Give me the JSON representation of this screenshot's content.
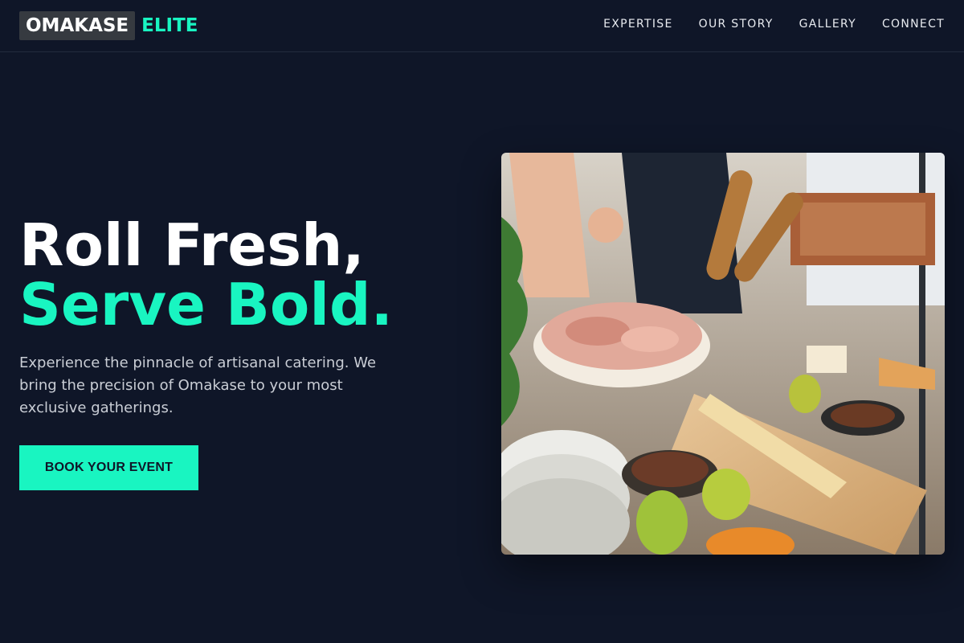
{
  "header": {
    "logo_main": "OMAKASE",
    "logo_accent": "ELITE",
    "nav": [
      {
        "label": "EXPERTISE"
      },
      {
        "label": "OUR STORY"
      },
      {
        "label": "GALLERY"
      },
      {
        "label": "CONNECT"
      }
    ]
  },
  "hero": {
    "title_line1": "Roll Fresh,",
    "title_line2": "Serve Bold.",
    "description": "Experience the pinnacle of artisanal catering. We bring the precision of Omakase to your most exclusive gatherings.",
    "cta_label": "BOOK YOUR EVENT",
    "image_icon": "catering-spread-photo"
  },
  "colors": {
    "background": "#0f1628",
    "accent": "#19f5c1",
    "logo_box": "#363a40",
    "text": "#ffffff",
    "muted_text": "#c9cdd5"
  }
}
